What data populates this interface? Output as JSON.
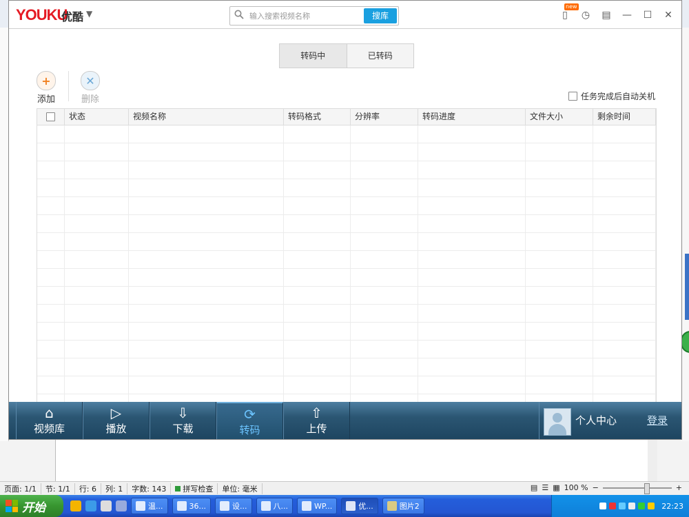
{
  "window": {
    "logo": "YOUKU",
    "logo_cn": "优酷",
    "new_badge": "new"
  },
  "search": {
    "placeholder": "输入搜索视频名称",
    "button": "搜库"
  },
  "tabs": [
    "转码中",
    "已转码"
  ],
  "toolbar": {
    "add": "添加",
    "delete": "删除",
    "auto_shutdown": "任务完成后自动关机"
  },
  "table": {
    "columns": [
      "状态",
      "视频名称",
      "转码格式",
      "分辨率",
      "转码进度",
      "文件大小",
      "剩余时间"
    ]
  },
  "nav": {
    "items": [
      "视频库",
      "播放",
      "下载",
      "转码",
      "上传"
    ],
    "active": "转码",
    "user_center": "个人中心",
    "login": "登录"
  },
  "statusbar": {
    "page": "页面: 1/1",
    "section": "节: 1/1",
    "line": "行: 6",
    "column": "列: 1",
    "words": "字数: 143",
    "spell": "拼写检查",
    "unit": "单位: 毫米",
    "zoom": "100 %"
  },
  "taskbar": {
    "start": "开始",
    "tasks": [
      "温...",
      "36...",
      "设...",
      "八...",
      "WP...",
      "优...",
      "图片2"
    ],
    "clock": "22:23"
  }
}
